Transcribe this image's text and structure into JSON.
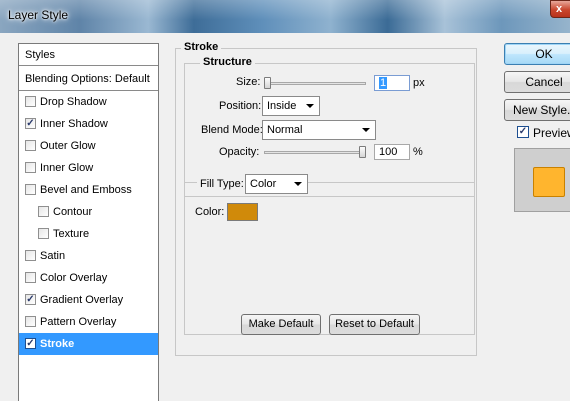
{
  "window": {
    "title": "Layer Style",
    "close_label": "x"
  },
  "styles_panel": {
    "header": "Styles",
    "blending_options": "Blending Options: Default",
    "items": [
      {
        "label": "Drop Shadow",
        "checked": false,
        "indent": false,
        "selected": false
      },
      {
        "label": "Inner Shadow",
        "checked": true,
        "indent": false,
        "selected": false
      },
      {
        "label": "Outer Glow",
        "checked": false,
        "indent": false,
        "selected": false
      },
      {
        "label": "Inner Glow",
        "checked": false,
        "indent": false,
        "selected": false
      },
      {
        "label": "Bevel and Emboss",
        "checked": false,
        "indent": false,
        "selected": false
      },
      {
        "label": "Contour",
        "checked": false,
        "indent": true,
        "selected": false
      },
      {
        "label": "Texture",
        "checked": false,
        "indent": true,
        "selected": false
      },
      {
        "label": "Satin",
        "checked": false,
        "indent": false,
        "selected": false
      },
      {
        "label": "Color Overlay",
        "checked": false,
        "indent": false,
        "selected": false
      },
      {
        "label": "Gradient Overlay",
        "checked": true,
        "indent": false,
        "selected": false
      },
      {
        "label": "Pattern Overlay",
        "checked": false,
        "indent": false,
        "selected": false
      },
      {
        "label": "Stroke",
        "checked": true,
        "indent": false,
        "selected": true
      }
    ],
    "check_glyph": "✓"
  },
  "stroke": {
    "title": "Stroke",
    "structure": {
      "title": "Structure",
      "size": {
        "label": "Size:",
        "value": "1",
        "unit": "px",
        "slider_fraction": 0.0
      },
      "position": {
        "label": "Position:",
        "value": "Inside"
      },
      "blend_mode": {
        "label": "Blend Mode:",
        "value": "Normal"
      },
      "opacity": {
        "label": "Opacity:",
        "value": "100",
        "unit": "%",
        "slider_fraction": 1.0
      }
    },
    "fill": {
      "type_label": "Fill Type:",
      "type_value": "Color",
      "color_label": "Color:",
      "color_hex": "#d08a0a"
    },
    "make_default": "Make Default",
    "reset_to_default": "Reset to Default"
  },
  "actions": {
    "ok": "OK",
    "cancel": "Cancel",
    "new_style": "New Style...",
    "preview_label": "Preview",
    "preview_checked": true
  },
  "preview": {
    "color_hex": "#ffb52e"
  },
  "icons": {
    "dropdown": "chevron-down-icon",
    "checkbox": "checkmark-icon",
    "close": "close-icon"
  }
}
